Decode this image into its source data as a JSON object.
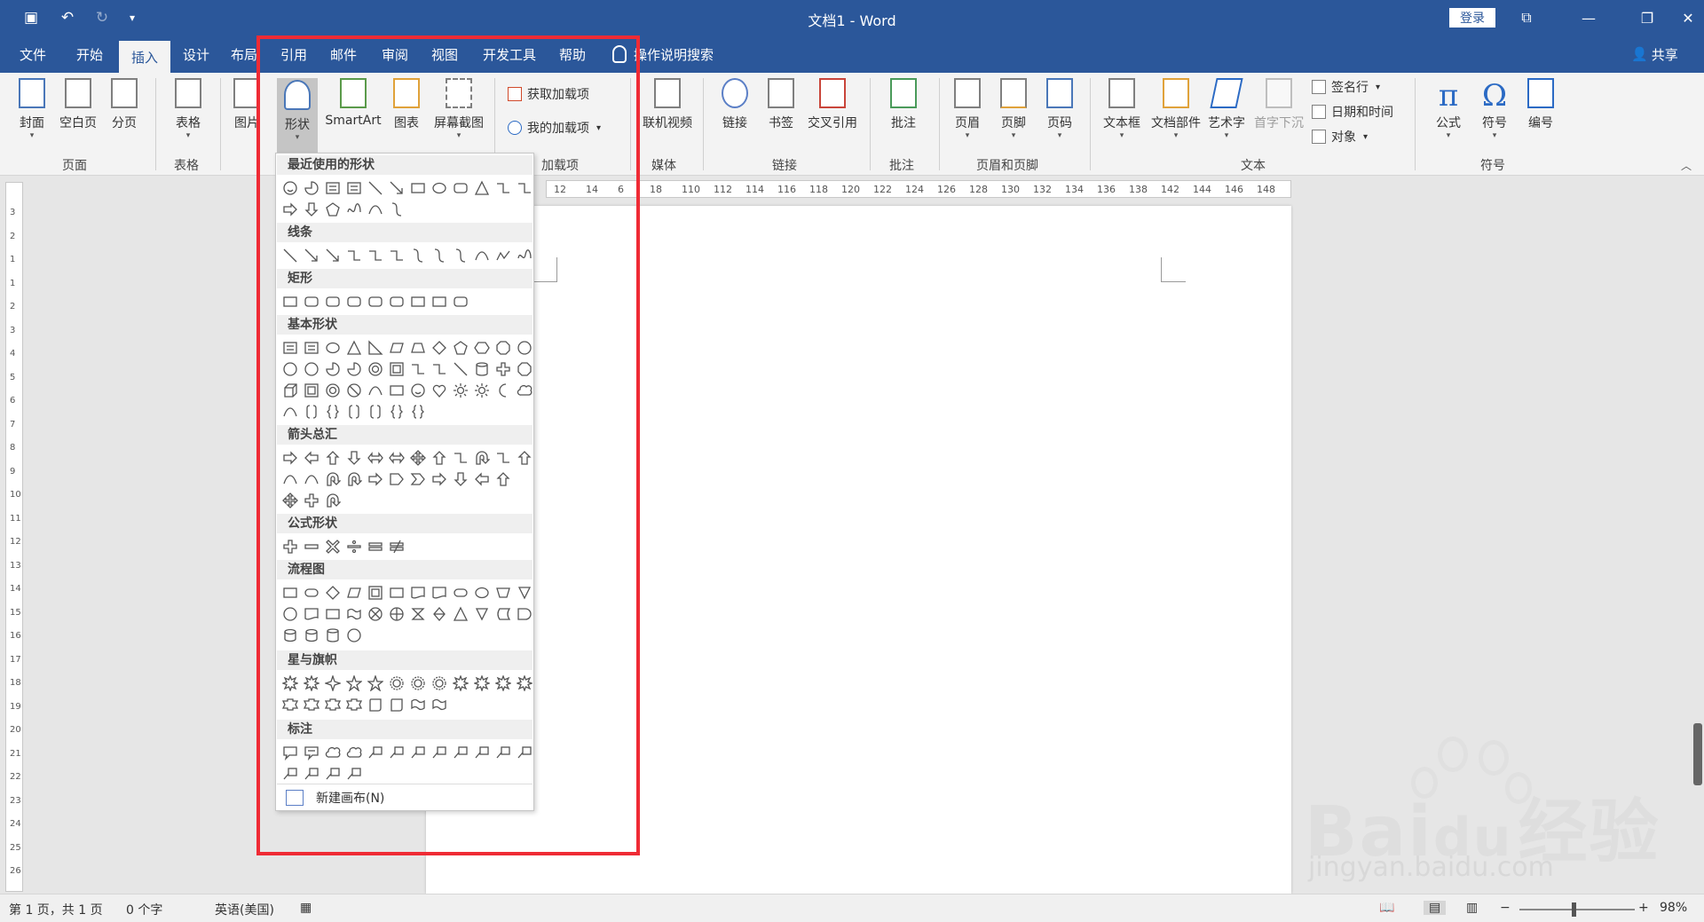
{
  "window": {
    "doc_title": "文档1  -  Word",
    "login_label": "登录",
    "quick_access": [
      "save-icon",
      "undo-icon",
      "redo-icon",
      "customize-icon"
    ]
  },
  "tabs": [
    "文件",
    "开始",
    "插入",
    "设计",
    "布局",
    "引用",
    "邮件",
    "审阅",
    "视图",
    "开发工具",
    "帮助"
  ],
  "active_tab": "插入",
  "tell_me": "操作说明搜索",
  "share": "共享",
  "ribbon": {
    "buttons": {
      "cover": "封面",
      "blank_page": "空白页",
      "page_break": "分页",
      "table": "表格",
      "picture": "图片",
      "shapes": "形状",
      "smartart": "SmartArt",
      "chart": "图表",
      "screenshot": "屏幕截图",
      "get_addins": "获取加载项",
      "my_addins": "我的加载项",
      "online_video": "联机视频",
      "link": "链接",
      "bookmark": "书签",
      "cross_ref": "交叉引用",
      "comment": "批注",
      "header": "页眉",
      "footer": "页脚",
      "page_number": "页码",
      "textbox": "文本框",
      "quick_parts": "文档部件",
      "wordart": "艺术字",
      "drop_cap": "首字下沉",
      "signature": "签名行",
      "date_time": "日期和时间",
      "object": "对象",
      "equation": "公式",
      "symbol": "符号",
      "number": "编号"
    },
    "groups": {
      "pages": "页面",
      "tables": "表格",
      "addins": "加载项",
      "media": "媒体",
      "links": "链接",
      "comments": "批注",
      "header_footer": "页眉和页脚",
      "text": "文本",
      "symbols": "符号"
    }
  },
  "shapes_panel": {
    "categories": [
      "最近使用的形状",
      "线条",
      "矩形",
      "基本形状",
      "箭头总汇",
      "公式形状",
      "流程图",
      "星与旗帜",
      "标注"
    ],
    "new_canvas": "新建画布(N)"
  },
  "ruler": {
    "h_ticks": [
      "12",
      "14",
      "6",
      "18",
      "110",
      "112",
      "114",
      "116",
      "118",
      "120",
      "122",
      "124",
      "126",
      "128",
      "130",
      "132",
      "134",
      "136",
      "138",
      "142",
      "144",
      "146",
      "148"
    ],
    "v_ticks": [
      "3",
      "2",
      "1",
      "1",
      "2",
      "3",
      "4",
      "5",
      "6",
      "7",
      "8",
      "9",
      "10",
      "11",
      "12",
      "13",
      "14",
      "15",
      "16",
      "17",
      "18",
      "19",
      "20",
      "21",
      "22",
      "23",
      "24",
      "25",
      "26"
    ]
  },
  "status": {
    "page": "第 1 页，共 1 页",
    "words": "0 个字",
    "language": "英语(美国)",
    "zoom": "98%"
  },
  "watermark": {
    "brand": "Bai",
    "brand_cn": "经验",
    "site": "jingyan.baidu.com"
  }
}
